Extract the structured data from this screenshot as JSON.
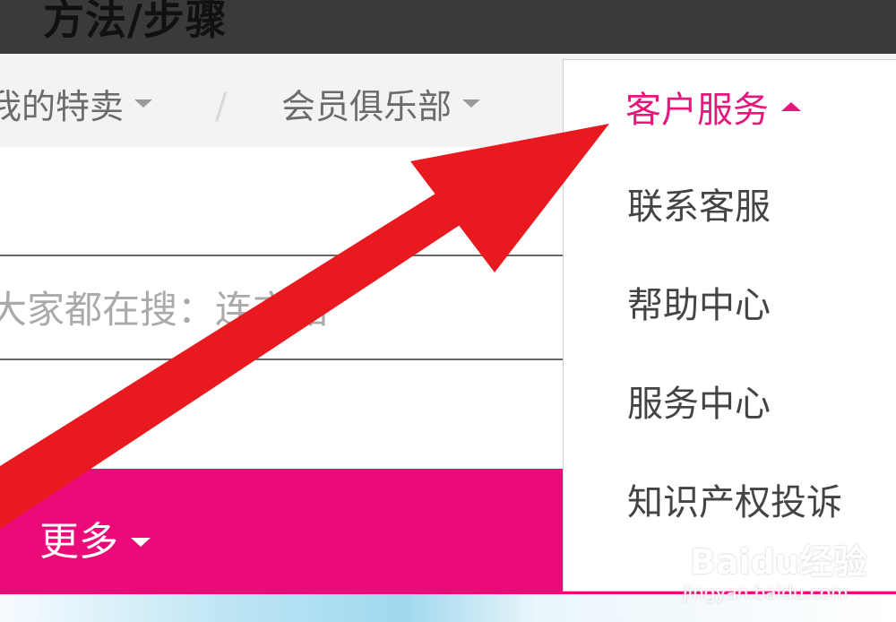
{
  "page": {
    "heading": "方法/步骤"
  },
  "navbar": {
    "items": [
      {
        "label": "我的特卖"
      },
      {
        "label": "会员俱乐部"
      }
    ],
    "separator": "/"
  },
  "customer_service_menu": {
    "header": "客户服务",
    "items": [
      {
        "label": "联系客服"
      },
      {
        "label": "帮助中心"
      },
      {
        "label": "服务中心"
      },
      {
        "label": "知识产权投诉"
      }
    ]
  },
  "search": {
    "placeholder": "大家都在搜：连衣裙"
  },
  "category_bar": {
    "more_label": "更多"
  },
  "watermark": {
    "logo": "Baidu经验",
    "url": "jingyan.baidu.com"
  },
  "colors": {
    "accent_pink": "#ec0a79",
    "menu_header_pink": "#e6177c",
    "annotation_red": "#e8191f",
    "header_dark": "#3a3a3a"
  },
  "icons": {
    "nav_caret": "chevron-down-icon",
    "menu_caret": "chevron-up-icon",
    "annotation": "red-arrow-icon"
  }
}
